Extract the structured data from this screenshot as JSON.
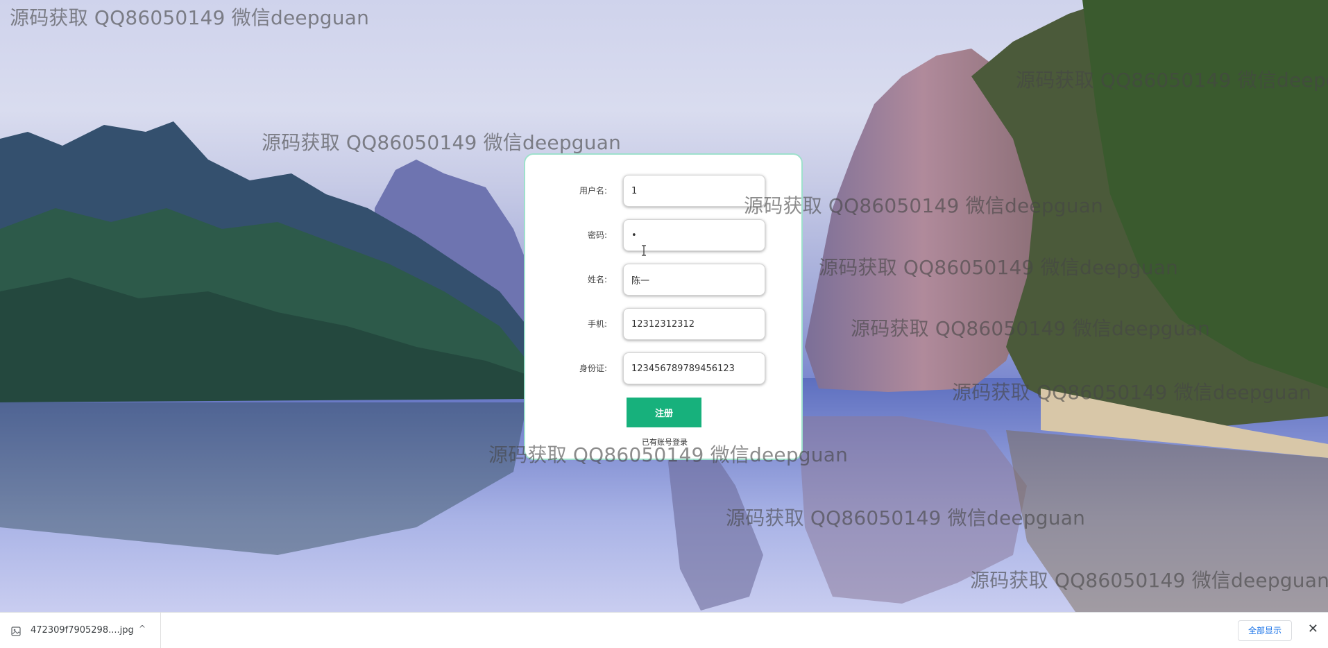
{
  "watermark": {
    "text": "源码获取 QQ86050149 微信deepguan"
  },
  "register_form": {
    "fields": [
      {
        "label": "用户名:",
        "value": "1"
      },
      {
        "label": "密码:",
        "value": "•"
      },
      {
        "label": "姓名:",
        "value": "陈一"
      },
      {
        "label": "手机:",
        "value": "12312312312"
      },
      {
        "label": "身份证:",
        "value": "123456789789456123"
      }
    ],
    "submit_label": "注册",
    "login_link": "已有账号登录"
  },
  "download_bar": {
    "file_name": "472309f7905298....jpg",
    "show_all": "全部显示",
    "close_glyph": "✕",
    "caret_glyph": "^"
  },
  "colors": {
    "accent": "#17b17c",
    "card_border": "#9ee0cc"
  }
}
